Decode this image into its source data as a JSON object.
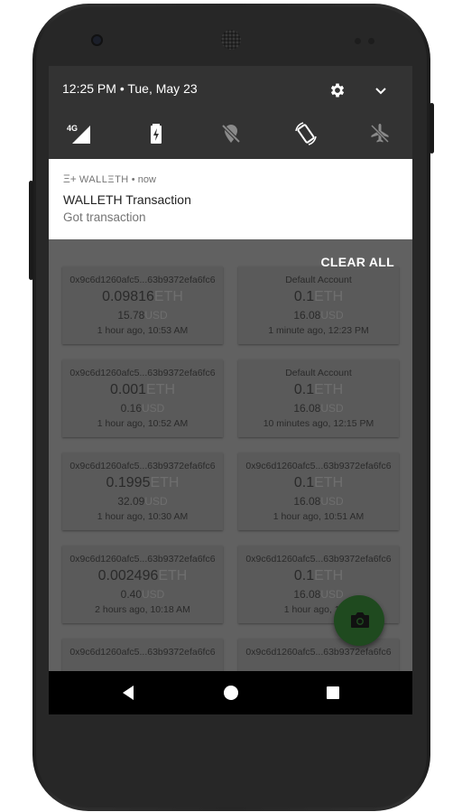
{
  "status": {
    "time_date": "12:25 PM • Tue, May 23",
    "network": "4G"
  },
  "quick_settings": [
    "network-4g-icon",
    "battery-charging-icon",
    "location-off-icon",
    "auto-rotate-icon",
    "airplane-mode-icon"
  ],
  "notification": {
    "app_name": "WALLΞTH",
    "when": "• now",
    "title": "WALLETH Transaction",
    "body": "Got transaction"
  },
  "clear_all": "CLEAR ALL",
  "transactions": [
    {
      "address": "0x9c6d1260afc5...63b9372efa6fc6",
      "amount": "0.09816",
      "amount_unit": "ETH",
      "usd": "15.78",
      "usd_unit": "USD",
      "time": "1 hour ago, 10:53 AM"
    },
    {
      "address": "Default Account",
      "amount": "0.1",
      "amount_unit": "ETH",
      "usd": "16.08",
      "usd_unit": "USD",
      "time": "1 minute ago, 12:23 PM"
    },
    {
      "address": "0x9c6d1260afc5...63b9372efa6fc6",
      "amount": "0.001",
      "amount_unit": "ETH",
      "usd": "0.16",
      "usd_unit": "USD",
      "time": "1 hour ago, 10:52 AM"
    },
    {
      "address": "Default Account",
      "amount": "0.1",
      "amount_unit": "ETH",
      "usd": "16.08",
      "usd_unit": "USD",
      "time": "10 minutes ago, 12:15 PM"
    },
    {
      "address": "0x9c6d1260afc5...63b9372efa6fc6",
      "amount": "0.1995",
      "amount_unit": "ETH",
      "usd": "32.09",
      "usd_unit": "USD",
      "time": "1 hour ago, 10:30 AM"
    },
    {
      "address": "0x9c6d1260afc5...63b9372efa6fc6",
      "amount": "0.1",
      "amount_unit": "ETH",
      "usd": "16.08",
      "usd_unit": "USD",
      "time": "1 hour ago, 10:51 AM"
    },
    {
      "address": "0x9c6d1260afc5...63b9372efa6fc6",
      "amount": "0.002496",
      "amount_unit": "ETH",
      "usd": "0.40",
      "usd_unit": "USD",
      "time": "2 hours ago, 10:18 AM"
    },
    {
      "address": "0x9c6d1260afc5...63b9372efa6fc6",
      "amount": "0.1",
      "amount_unit": "ETH",
      "usd": "16.08",
      "usd_unit": "USD",
      "time": "1 hour ago, 10:5"
    },
    {
      "address": "0x9c6d1260afc5...63b9372efa6fc6",
      "amount": "",
      "amount_unit": "",
      "usd": "",
      "usd_unit": "",
      "time": ""
    },
    {
      "address": "0x9c6d1260afc5...63b9372efa6fc6",
      "amount": "",
      "amount_unit": "",
      "usd": "",
      "usd_unit": "",
      "time": ""
    }
  ],
  "fab_icon": "camera-icon",
  "nav": [
    "back-icon",
    "home-icon",
    "recents-icon"
  ],
  "colors": {
    "shade": "#333333",
    "scrim": "#616161",
    "fab": "#1f4a1f"
  }
}
